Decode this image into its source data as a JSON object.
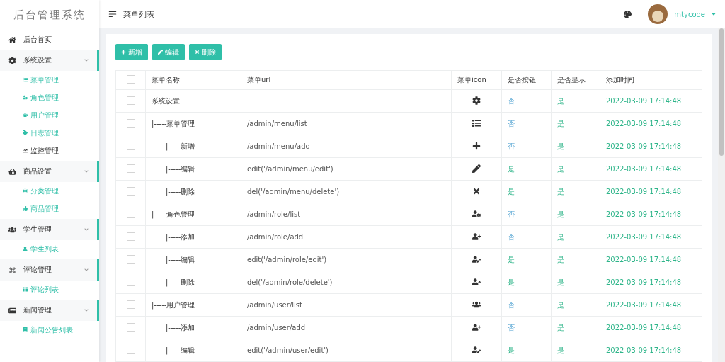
{
  "sidebar": {
    "title": "后台管理系统",
    "items": [
      {
        "label": "后台首页",
        "kind": "home"
      },
      {
        "label": "系统设置",
        "kind": "gear",
        "expanded": true,
        "children": [
          {
            "label": "菜单管理",
            "kind": "list",
            "active": true
          },
          {
            "label": "角色管理",
            "kind": "user-gear",
            "active": true
          },
          {
            "label": "用户管理",
            "kind": "users",
            "active": true
          },
          {
            "label": "日志管理",
            "kind": "tag",
            "active": true
          },
          {
            "label": "监控管理",
            "kind": "chart",
            "active": false
          }
        ]
      },
      {
        "label": "商品设置",
        "kind": "basket",
        "expanded": true,
        "children": [
          {
            "label": "分类管理",
            "kind": "asterisk",
            "active": true
          },
          {
            "label": "商品管理",
            "kind": "thumb",
            "active": true
          }
        ]
      },
      {
        "label": "学生管理",
        "kind": "users",
        "expanded": true,
        "children": [
          {
            "label": "学生列表",
            "kind": "user",
            "active": true
          }
        ]
      },
      {
        "label": "评论管理",
        "kind": "command",
        "expanded": true,
        "children": [
          {
            "label": "评论列表",
            "kind": "grid",
            "active": true
          }
        ]
      },
      {
        "label": "新闻管理",
        "kind": "news",
        "expanded": true,
        "children": [
          {
            "label": "新闻公告列表",
            "kind": "book",
            "active": true
          }
        ]
      }
    ]
  },
  "header": {
    "title": "菜单列表",
    "user": "mtycode"
  },
  "toolbar": [
    {
      "label": "新增",
      "kind": "plus"
    },
    {
      "label": "编辑",
      "kind": "pencil"
    },
    {
      "label": "删除",
      "kind": "close"
    }
  ],
  "table": {
    "select_all": {
      "checked": false
    },
    "columns": [
      "菜单名称",
      "菜单url",
      "菜单icon",
      "是否按钮",
      "是否显示",
      "添加时间"
    ],
    "rows": [
      {
        "checked": false,
        "name": "系统设置",
        "indent": false,
        "url": "",
        "kind": "gear",
        "is_button": {
          "text": "否",
          "kind": "no"
        },
        "is_show": {
          "text": "是",
          "kind": "yes"
        },
        "time": "2022-03-09 17:14:48"
      },
      {
        "checked": false,
        "name": "|-----菜单管理",
        "indent": false,
        "url": "/admin/menu/list",
        "kind": "list",
        "is_button": {
          "text": "否",
          "kind": "no"
        },
        "is_show": {
          "text": "是",
          "kind": "yes"
        },
        "time": "2022-03-09 17:14:48"
      },
      {
        "checked": false,
        "name": "|-----新增",
        "indent": true,
        "url": "/admin/menu/add",
        "kind": "plus",
        "is_button": {
          "text": "否",
          "kind": "no"
        },
        "is_show": {
          "text": "是",
          "kind": "yes"
        },
        "time": "2022-03-09 17:14:48"
      },
      {
        "checked": false,
        "name": "|-----编辑",
        "indent": true,
        "url": "edit('/admin/menu/edit')",
        "kind": "pencil",
        "is_button": {
          "text": "是",
          "kind": "yes"
        },
        "is_show": {
          "text": "是",
          "kind": "yes"
        },
        "time": "2022-03-09 17:14:48"
      },
      {
        "checked": false,
        "name": "|-----删除",
        "indent": true,
        "url": "del('/admin/menu/delete')",
        "kind": "close",
        "is_button": {
          "text": "是",
          "kind": "yes"
        },
        "is_show": {
          "text": "是",
          "kind": "yes"
        },
        "time": "2022-03-09 17:14:48"
      },
      {
        "checked": false,
        "name": "|-----角色管理",
        "indent": false,
        "url": "/admin/role/list",
        "kind": "user-gear",
        "is_button": {
          "text": "否",
          "kind": "no"
        },
        "is_show": {
          "text": "是",
          "kind": "yes"
        },
        "time": "2022-03-09 17:14:48"
      },
      {
        "checked": false,
        "name": "|-----添加",
        "indent": true,
        "url": "/admin/role/add",
        "kind": "user-plus",
        "is_button": {
          "text": "否",
          "kind": "no"
        },
        "is_show": {
          "text": "是",
          "kind": "yes"
        },
        "time": "2022-03-09 17:14:48"
      },
      {
        "checked": false,
        "name": "|-----编辑",
        "indent": true,
        "url": "edit('/admin/role/edit')",
        "kind": "user-edit",
        "is_button": {
          "text": "是",
          "kind": "yes"
        },
        "is_show": {
          "text": "是",
          "kind": "yes"
        },
        "time": "2022-03-09 17:14:48"
      },
      {
        "checked": false,
        "name": "|-----删除",
        "indent": true,
        "url": "del('/admin/role/delete')",
        "kind": "user-remove",
        "is_button": {
          "text": "是",
          "kind": "yes"
        },
        "is_show": {
          "text": "是",
          "kind": "yes"
        },
        "time": "2022-03-09 17:14:48"
      },
      {
        "checked": false,
        "name": "|-----用户管理",
        "indent": false,
        "url": "/admin/user/list",
        "kind": "users",
        "is_button": {
          "text": "否",
          "kind": "no"
        },
        "is_show": {
          "text": "是",
          "kind": "yes"
        },
        "time": "2022-03-09 17:14:48"
      },
      {
        "checked": false,
        "name": "|-----添加",
        "indent": true,
        "url": "/admin/user/add",
        "kind": "user-plus",
        "is_button": {
          "text": "否",
          "kind": "no"
        },
        "is_show": {
          "text": "是",
          "kind": "yes"
        },
        "time": "2022-03-09 17:14:48"
      },
      {
        "checked": false,
        "name": "|-----编辑",
        "indent": true,
        "url": "edit('/admin/user/edit')",
        "kind": "user-edit",
        "is_button": {
          "text": "是",
          "kind": "yes"
        },
        "is_show": {
          "text": "是",
          "kind": "yes"
        },
        "time": "2022-03-09 17:14:48"
      }
    ]
  }
}
